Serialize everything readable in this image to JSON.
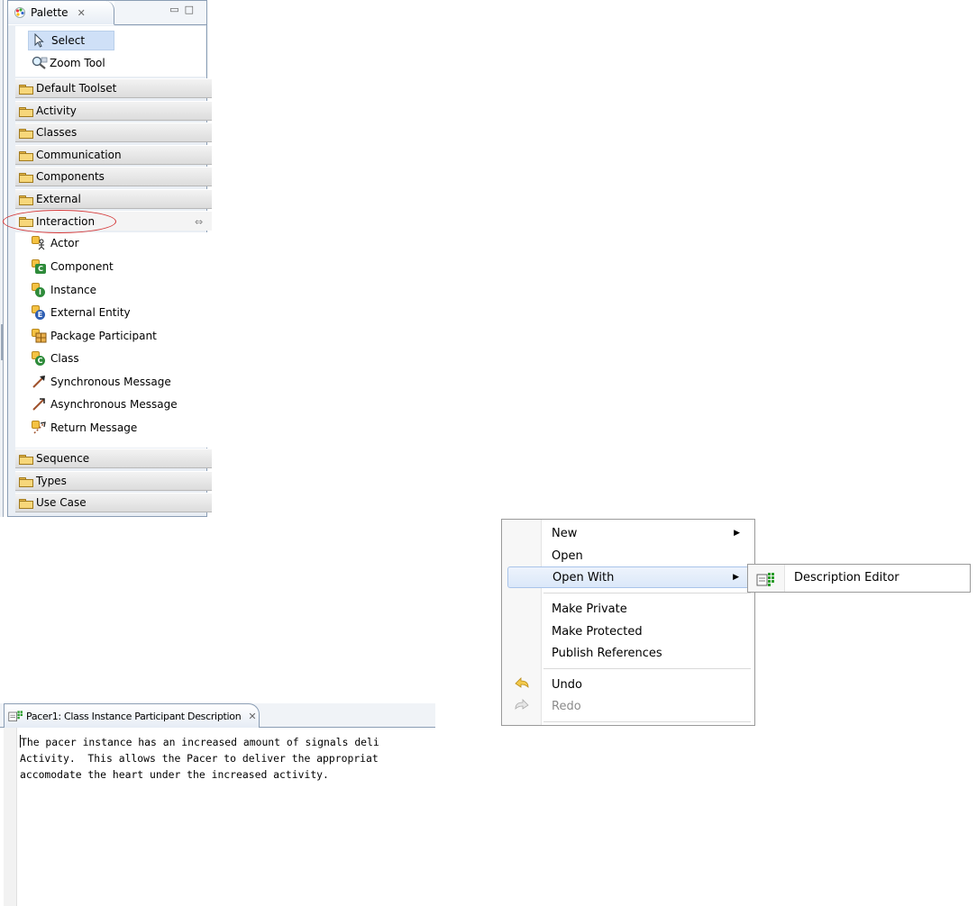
{
  "palette": {
    "title": "Palette",
    "tools": [
      {
        "label": "Select",
        "icon": "arrow-pointer-icon"
      },
      {
        "label": "Zoom Tool",
        "icon": "magnifier-icon"
      }
    ],
    "drawers_top": [
      "Default Toolset",
      "Activity",
      "Classes",
      "Communication",
      "Components",
      "External"
    ],
    "open_drawer": "Interaction",
    "entries": [
      {
        "label": "Actor",
        "icon": "actor-icon"
      },
      {
        "label": "Component",
        "icon": "component-icon"
      },
      {
        "label": "Instance",
        "icon": "instance-icon"
      },
      {
        "label": "External Entity",
        "icon": "external-entity-icon"
      },
      {
        "label": "Package Participant",
        "icon": "package-participant-icon"
      },
      {
        "label": "Class",
        "icon": "class-icon"
      },
      {
        "label": "Synchronous Message",
        "icon": "sync-message-icon"
      },
      {
        "label": "Asynchronous Message",
        "icon": "async-message-icon"
      },
      {
        "label": "Return Message",
        "icon": "return-message-icon"
      }
    ],
    "drawers_bottom": [
      "Sequence",
      "Types",
      "Use Case"
    ],
    "colors": {
      "highlight_oval": "#d43636",
      "selected_tool": "#cfe0f7"
    }
  },
  "context_menu": {
    "items": [
      {
        "label": "New",
        "has_submenu": true
      },
      {
        "label": "Open",
        "has_submenu": false
      },
      {
        "label": "Open With",
        "has_submenu": true,
        "highlighted": true
      },
      {
        "label": "Make Private"
      },
      {
        "label": "Make Protected"
      },
      {
        "label": "Publish References"
      },
      {
        "label": "Undo",
        "icon": "undo-icon"
      },
      {
        "label": "Redo",
        "icon": "redo-icon",
        "disabled": true
      }
    ],
    "submenu": {
      "label": "Description Editor",
      "icon": "description-editor-icon"
    }
  },
  "editor": {
    "tab_title": "Pacer1: Class Instance Participant Description",
    "lines": [
      "The pacer instance has an increased amount of signals deli",
      "Activity.  This allows the Pacer to deliver the appropriat",
      "accomodate the heart under the increased activity."
    ]
  }
}
